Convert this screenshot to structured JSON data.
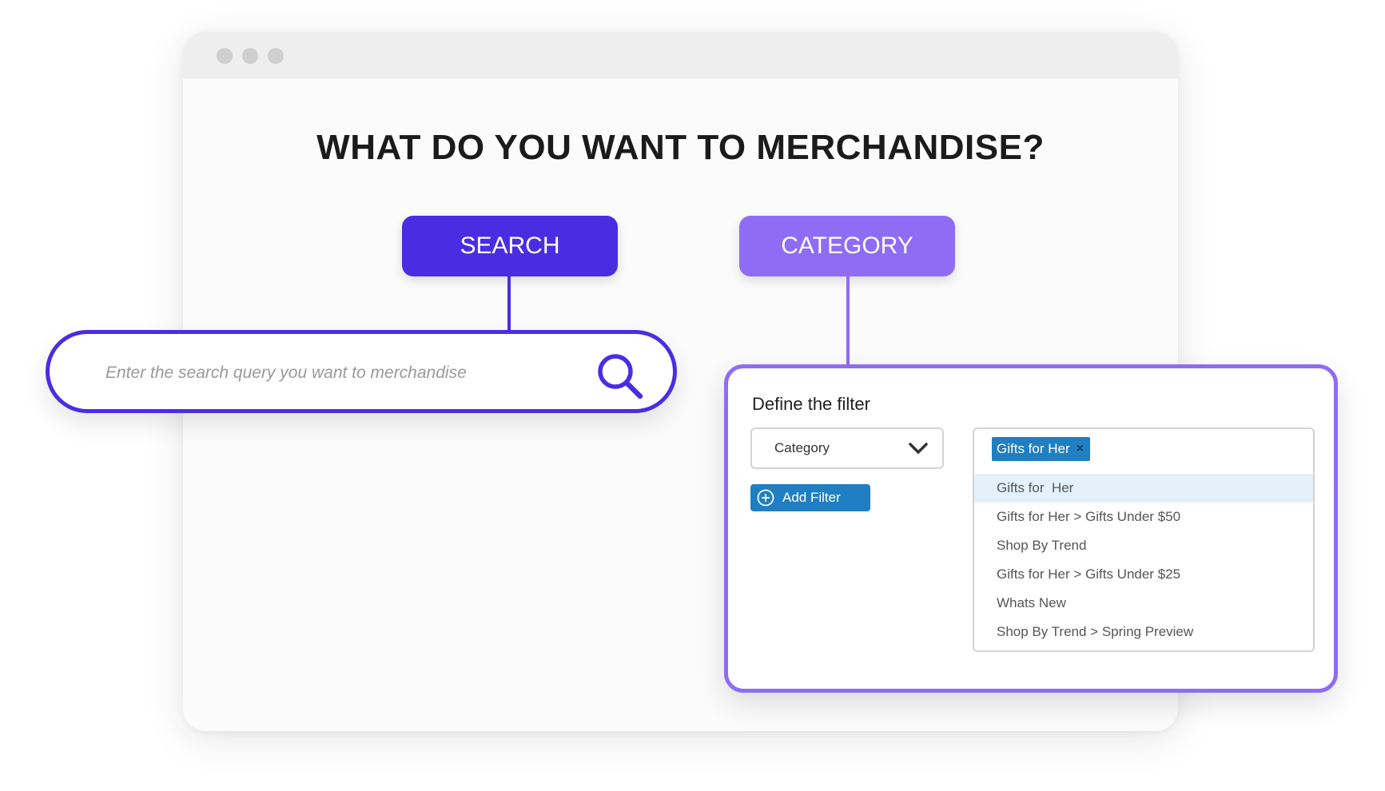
{
  "window": {
    "controls": [
      "close-dot",
      "minimize-dot",
      "maximize-dot"
    ]
  },
  "headline": "WHAT DO YOU WANT TO MERCHANDISE?",
  "modes": {
    "search_label": "SEARCH",
    "category_label": "CATEGORY"
  },
  "search": {
    "placeholder": "Enter the search query you want to merchandise",
    "icon": "search-icon"
  },
  "filter": {
    "title": "Define the filter",
    "select_value": "Category",
    "add_filter_label": "Add Filter",
    "selected_tag": "Gifts for Her",
    "tag_close": "×",
    "options": [
      "Gifts for  Her",
      "Gifts for Her > Gifts Under $50",
      "Shop By Trend",
      "Gifts for Her > Gifts Under $25",
      "Whats New",
      "Shop By Trend > Spring Preview"
    ],
    "highlighted_option_index": 0
  },
  "colors": {
    "search_accent": "#4a2de3",
    "category_accent": "#8f6cf4",
    "filter_blue": "#1f7fc2"
  }
}
